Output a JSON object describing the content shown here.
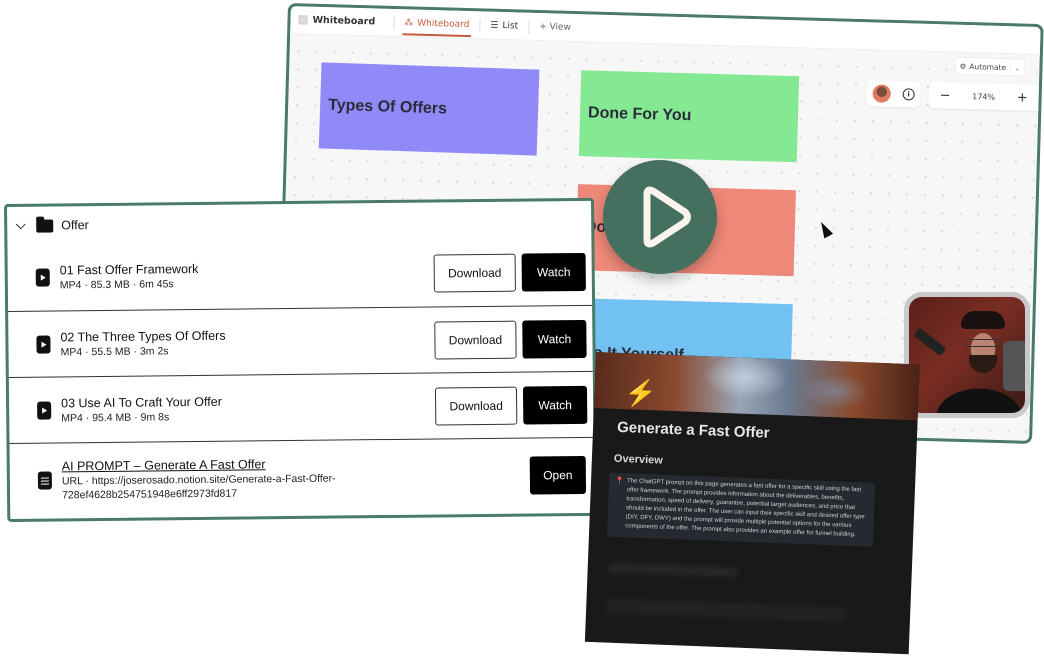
{
  "whiteboard": {
    "title": "Whiteboard",
    "tabs": [
      {
        "label": "Whiteboard",
        "icon": "whiteboard-icon",
        "active": true
      },
      {
        "label": "List",
        "icon": "list-icon",
        "active": false
      }
    ],
    "add_view_label": "+ View",
    "automate_label": "Automate",
    "zoom_level": "174%",
    "zoom_out": "−",
    "zoom_in": "+",
    "info_icon": "i",
    "accent_color": "#c75b3f",
    "stickies": [
      {
        "text": "Types Of Offers",
        "color": "#8f8af7"
      },
      {
        "text": "Done For You",
        "color": "#85e994"
      },
      {
        "text": "Done With You",
        "color": "#ee8878"
      },
      {
        "text": "Do It Yourself",
        "color": "#71c1f3"
      }
    ]
  },
  "course": {
    "folder_label": "Offer",
    "items": [
      {
        "title": "01 Fast Offer Framework",
        "meta": "MP4 · 85.3 MB · 6m 45s",
        "download": "Download",
        "watch": "Watch"
      },
      {
        "title": "02 The Three Types Of Offers",
        "meta": "MP4 · 55.5 MB · 3m 2s",
        "download": "Download",
        "watch": "Watch"
      },
      {
        "title": "03 Use AI To Craft Your Offer",
        "meta": "MP4 · 95.4 MB · 9m 8s",
        "download": "Download",
        "watch": "Watch"
      }
    ],
    "prompt": {
      "title": "AI PROMPT – Generate A Fast Offer",
      "meta_line1": "URL · https://joserosado.notion.site/Generate-a-Fast-Offer-",
      "meta_line2": "728ef4628b254751948e6ff2973fd817",
      "open": "Open"
    },
    "border_color": "#4a7a68"
  },
  "notion": {
    "title": "Generate a Fast Offer",
    "section": "Overview",
    "callout": "The ChatGPT prompt on this page generates a fast offer for a specific skill using the fast offer framework. The prompt provides information about the deliverables, benefits, transformation, speed of delivery, guarantee, potential target audiences, and price that should be included in the offer. The user can input their specific skill and desired offer type (DIY, DFY, DWY) and the prompt will provide multiple potential options for the various components of the offer. The prompt also provides an example offer for funnel building."
  },
  "play_button_color": "#45705f"
}
